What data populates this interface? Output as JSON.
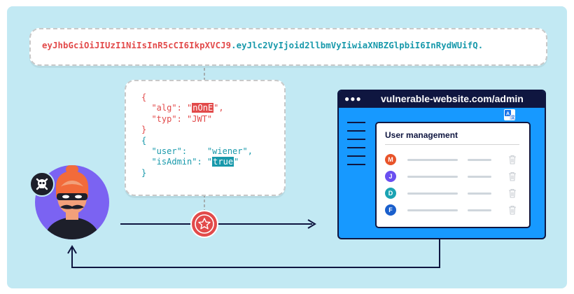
{
  "token": {
    "header_part": "eyJhbGciOiJIUzI1NiIsInR5cCI6IkpXVCJ9",
    "separator": ".",
    "payload_part": "eyJlc2VyIjoid2llbmVyIiwiaXNBZGlpbiI6InRydWUifQ",
    "trailing_dot": "."
  },
  "jwt_header": {
    "open": "{",
    "alg_key": "\"alg\"",
    "alg_value": "nOnE",
    "typ_key": "\"typ\"",
    "typ_value": "\"JWT\"",
    "close": "}"
  },
  "jwt_payload": {
    "open": "{",
    "user_key": "\"user\"",
    "user_value": "\"wiener\"",
    "admin_key": "\"isAdmin\"",
    "admin_value": "true",
    "close": "}"
  },
  "browser": {
    "dots": "●●●",
    "url": "vulnerable-website.com/admin",
    "card_title": "User management",
    "users": [
      {
        "initial": "M",
        "color": "#e8542a"
      },
      {
        "initial": "J",
        "color": "#6a4ff0"
      },
      {
        "initial": "D",
        "color": "#1aa3b3"
      },
      {
        "initial": "F",
        "color": "#1a5fcc"
      }
    ]
  },
  "icons": {
    "attacker": "hacker-avatar",
    "badge": "skull-crossbones-icon",
    "exploit": "star-target-icon",
    "translate": "translate-icon",
    "delete": "trash-icon"
  },
  "colors": {
    "background": "#c2e9f3",
    "red": "#e24a4a",
    "teal": "#1899ab",
    "navy": "#0f1640",
    "browser_blue": "#1799ff",
    "avatar_purple": "#7b63f2"
  }
}
